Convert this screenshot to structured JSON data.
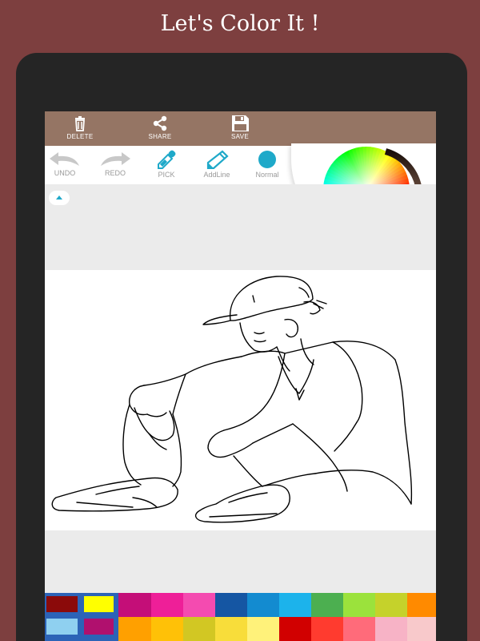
{
  "headline": "Let's Color It !",
  "topbar": {
    "delete_label": "DELETE",
    "share_label": "SHARE",
    "save_label": "SAVE"
  },
  "tools": {
    "undo_label": "UNDO",
    "redo_label": "REDO",
    "pick_label": "PICK",
    "addline_label": "AddLine",
    "normal_label": "Normal"
  },
  "colors": {
    "background": "#7d3f3f",
    "device": "#252525",
    "topbar": "#957564",
    "accent": "#1fa9c9",
    "workspace": "#ebebeb"
  },
  "icons": {
    "delete": "trash-icon",
    "share": "share-icon",
    "save": "floppy-disk-icon",
    "undo": "undo-arrow-icon",
    "redo": "redo-arrow-icon",
    "pick": "eyedropper-icon",
    "addline": "pencil-icon",
    "normal": "brush-dot-icon"
  },
  "palette": {
    "row1": [
      "#8b0a0a",
      "#ffff00",
      "#c40e78",
      "#ee1f98",
      "#f44bb0",
      "#1556a3",
      "#138bd0",
      "#1cb3eb",
      "#4caf50",
      "#9be23c",
      "#c5d22b",
      "#ff8a00"
    ],
    "row2": [
      "#8fd0f0",
      "#b0106e",
      "#ffa000",
      "#ffc107",
      "#d2c723",
      "#f8dd3a",
      "#fff27a",
      "#d10000",
      "#ff3b2f",
      "#ff6b7a",
      "#f7b3c6",
      "#f8c9cb"
    ]
  }
}
